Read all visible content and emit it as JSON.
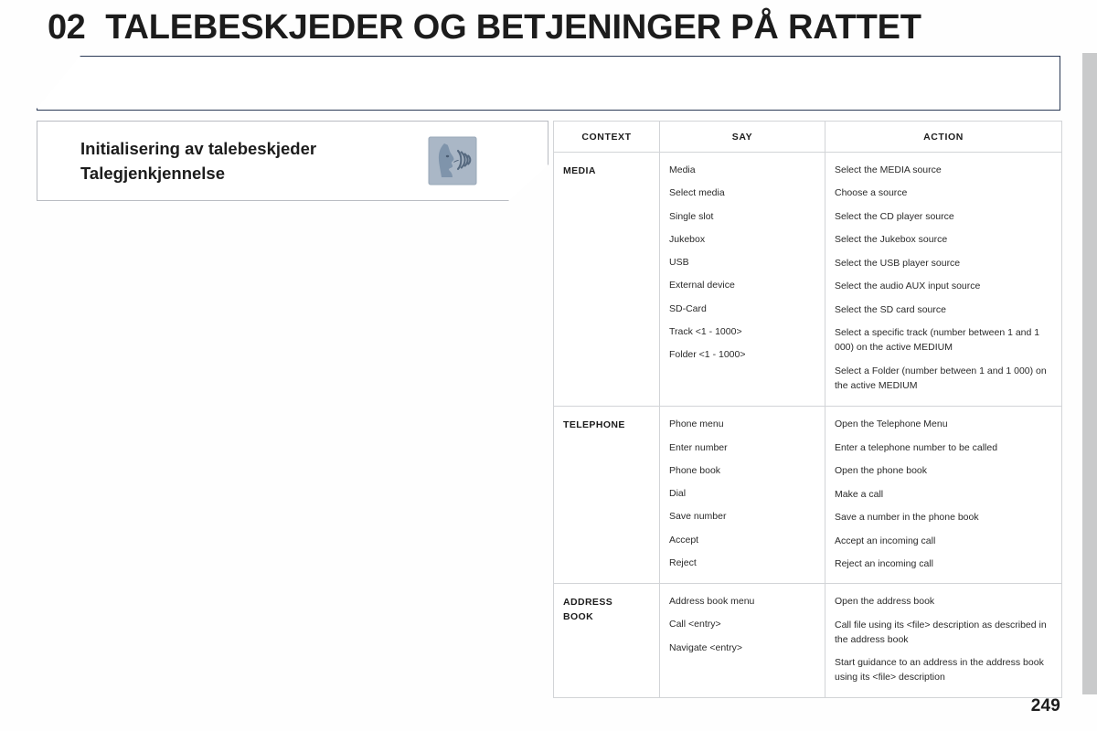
{
  "chapter": {
    "number": "02",
    "title": "TALEBESKJEDER OG BETJENINGER PÅ RATTET"
  },
  "subtitle": {
    "line1": "Initialisering av talebeskjeder",
    "line2": "Talegjenkjennelse",
    "icon": "speech-recognition-icon"
  },
  "table": {
    "headers": {
      "context": "CONTEXT",
      "say": "SAY",
      "action": "ACTION"
    },
    "sections": [
      {
        "context": "MEDIA",
        "context_lines": [
          "MEDIA"
        ],
        "say": [
          "Media",
          "Select media",
          "Single slot",
          "Jukebox",
          "USB",
          "External device",
          "SD-Card",
          "Track <1 - 1000>",
          "Folder <1 - 1000>"
        ],
        "action": [
          "Select the MEDIA source",
          "Choose a source",
          "Select the CD player source",
          "Select the Jukebox source",
          "Select the USB player source",
          "Select the audio AUX input source",
          "Select the SD card source",
          "Select a specific track (number between 1 and 1 000) on the active MEDIUM",
          "Select a Folder (number between 1 and 1 000) on the active MEDIUM"
        ]
      },
      {
        "context": "TELEPHONE",
        "context_lines": [
          "TELEPHONE"
        ],
        "say": [
          "Phone menu",
          "Enter number",
          "Phone book",
          "Dial",
          "Save number",
          "Accept",
          "Reject"
        ],
        "action": [
          "Open the Telephone Menu",
          "Enter a telephone number to be called",
          "Open the phone book",
          "Make a call",
          "Save a number in the phone book",
          "Accept an incoming call",
          "Reject an incoming call"
        ]
      },
      {
        "context": "ADDRESS BOOK",
        "context_lines": [
          "ADDRESS",
          "BOOK"
        ],
        "say": [
          "Address book menu",
          "Call <entry>",
          "Navigate <entry>"
        ],
        "action": [
          "Open the address book",
          "Call file using its <file> description as described in the address book",
          "Start guidance to an address in the address book using its <file> description"
        ]
      }
    ]
  },
  "page_number": "249",
  "colors": {
    "banner_border": "#2b3a56",
    "panel_border": "#b9bcc2",
    "table_border": "#d2d4d7",
    "edge_band": "#c9cacb",
    "text": "#1c1c1c",
    "icon_fill": "#8fa0b3"
  }
}
